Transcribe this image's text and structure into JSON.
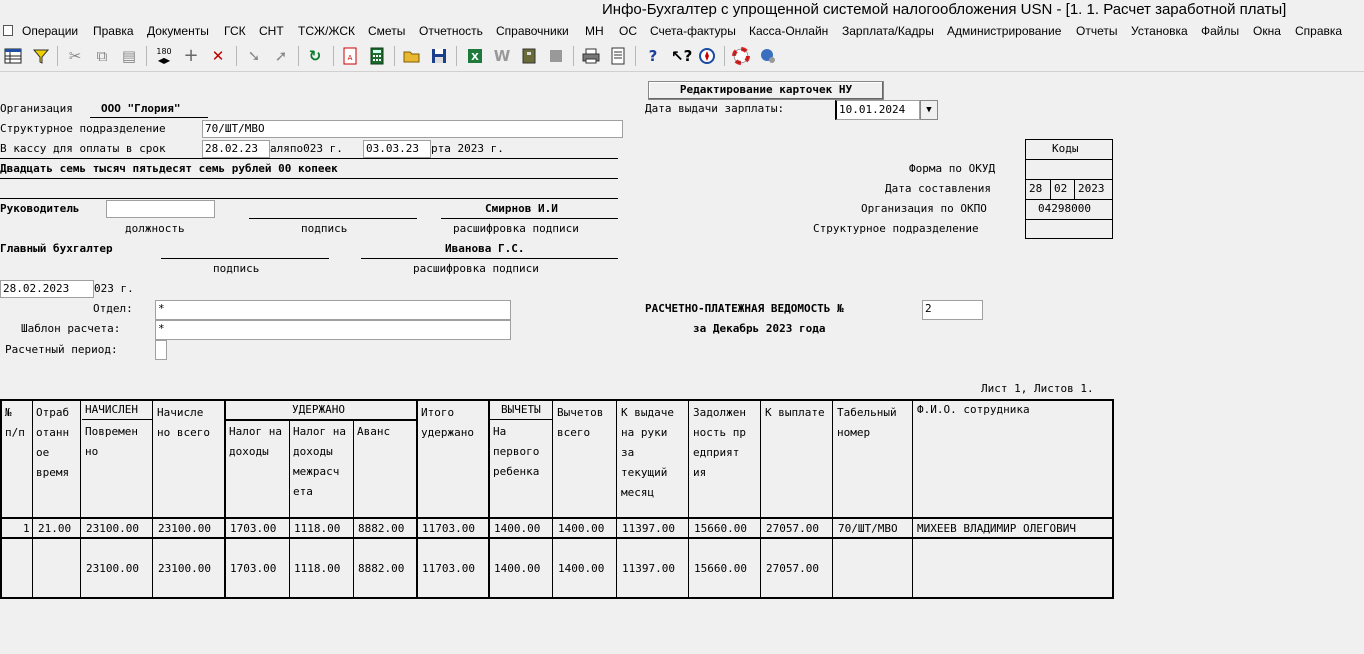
{
  "window": {
    "title": "Инфо-Бухгалтер с упрощенной системой налогообложения   USN   - [1. 1. Расчет заработной платы]"
  },
  "menu": [
    "Операции",
    "Правка",
    "Документы",
    "ГСК",
    "СНТ",
    "ТСЖ/ЖСК",
    "Сметы",
    "Отчетность",
    "Справочники",
    "МН",
    "ОС",
    "Счета-фактуры",
    "Касса-Онлайн",
    "Зарплата/Кадры",
    "Администрирование",
    "Отчеты",
    "Установка",
    "Файлы",
    "Окна",
    "Справка"
  ],
  "toolbar_icons": [
    "table-icon",
    "filter-icon",
    "cut-icon",
    "copy-icon",
    "paste-icon",
    "renumber-icon",
    "add-icon",
    "delete-icon",
    "mark-icon",
    "unmark-icon",
    "refresh-icon",
    "pdf-icon",
    "calculator-icon",
    "open-icon",
    "save-icon",
    "excel-icon",
    "word-icon",
    "archive-icon",
    "stop-icon",
    "print-icon",
    "preview-icon",
    "help-icon",
    "context-help-icon",
    "compass-icon",
    "lifebuoy-icon",
    "web-icon"
  ],
  "form": {
    "edit_cards_button": "Редактирование карточек НУ",
    "pay_date_label": "Дата выдачи зарплаты:",
    "pay_date_value": "10.01.2024",
    "org_label": "Организация",
    "org_value": "ООО \"Глория\"",
    "struct_label": "Структурное подразделение",
    "struct_value": "70/ШТ/МВО",
    "cash_label": "В кассу для оплаты в срок",
    "cash_from": "28.02.23",
    "cash_mid": "аляпо023 г.",
    "cash_to": "03.03.23",
    "cash_tail": "рта 2023 г.",
    "amount_words": "Двадцать семь тысяч пятьдесят семь рублей 00 копеек",
    "head_label": "Руководитель",
    "head_name": "Смирнов И.И",
    "position_label": "должность",
    "signature_label": "подпись",
    "decoding_label": "расшифровка подписи",
    "chief_acc_label": "Главный бухгалтер",
    "chief_acc_name": "Иванова Г.С.",
    "signature_label2": "подпись",
    "decoding_label2": "расшифровка подписи",
    "doc_date": "28.02.2023",
    "doc_date_tail": "023 г.",
    "dept_label": "Отдел:",
    "dept_value": "*",
    "template_label": "Шаблон расчета:",
    "template_value": "*",
    "period_label": "Расчетный период:",
    "period_value": "",
    "statement_title": "РАСЧЕТНО-ПЛАТЕЖНАЯ ВЕДОМОСТЬ №",
    "statement_no": "2",
    "statement_period": "за Декабрь 2023 года",
    "sheet_info": "Лист 1, Листов 1."
  },
  "codes": {
    "header": "Коды",
    "rows": [
      {
        "label": "Форма по ОКУД",
        "value": ""
      },
      {
        "label": "Дата составления",
        "d": "28",
        "m": "02",
        "y": "2023"
      },
      {
        "label": "Организация по ОКПО",
        "value": "04298000"
      },
      {
        "label": "Структурное подразделение",
        "value": ""
      }
    ]
  },
  "table": {
    "headers": {
      "no": "№ п/п",
      "worked": "Отраб отанн ое время",
      "accrued_group": "НАЧИСЛЕН",
      "accrued_time": "Повремен но",
      "accrued_total": "Начисле но всего",
      "withheld_group": "УДЕРЖАНО",
      "tax": "Налог на доходы",
      "tax_inter": "Налог на доходы межрасч ета",
      "advance": "Аванс",
      "withheld_total": "Итого удержано",
      "deductions_group": "ВЫЧЕТЫ",
      "deduction_child": "На первого ребенка",
      "deductions_total": "Вычетов всего",
      "to_pay_month": "К выдаче на руки за текущий месяц",
      "debt": "Задолжен ность пр едприят ия",
      "to_pay": "К выплате",
      "tab_no": "Табельный номер",
      "fio": "Ф.И.О. сотрудника"
    },
    "row": {
      "no": "1",
      "worked": "21.00",
      "accrued_time": "23100.00",
      "accrued_total": "23100.00",
      "tax": "1703.00",
      "tax_inter": "1118.00",
      "advance": "8882.00",
      "withheld_total": "11703.00",
      "deduction_child": "1400.00",
      "deductions_total": "1400.00",
      "to_pay_month": "11397.00",
      "debt": "15660.00",
      "to_pay": "27057.00",
      "tab_no": "70/ШТ/МВО",
      "fio": "МИХЕЕВ ВЛАДИМИР ОЛЕГОВИЧ"
    },
    "total": {
      "accrued_time": "23100.00",
      "accrued_total": "23100.00",
      "tax": "1703.00",
      "tax_inter": "1118.00",
      "advance": "8882.00",
      "withheld_total": "11703.00",
      "deduction_child": "1400.00",
      "deductions_total": "1400.00",
      "to_pay_month": "11397.00",
      "debt": "15660.00",
      "to_pay": "27057.00"
    }
  }
}
